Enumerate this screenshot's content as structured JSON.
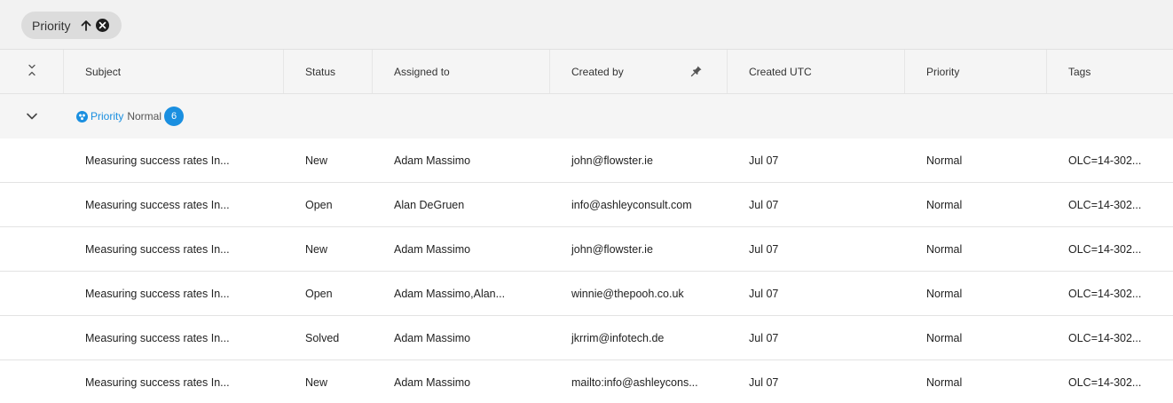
{
  "sort_chip": {
    "label": "Priority",
    "direction_icon": "arrow-up-icon",
    "remove_icon": "close-circle-icon"
  },
  "columns": [
    {
      "label": "Subject"
    },
    {
      "label": "Status"
    },
    {
      "label": "Assigned to"
    },
    {
      "label": "Created by",
      "icon": "pin-icon"
    },
    {
      "label": "Created UTC"
    },
    {
      "label": "Priority"
    },
    {
      "label": "Tags"
    }
  ],
  "group": {
    "field": "Priority",
    "value": "Normal",
    "count": "6",
    "icon": "group-icon",
    "accent_color": "#1a8fe0"
  },
  "rows": [
    {
      "subject": "Measuring success rates In...",
      "status": "New",
      "assigned": "Adam Massimo",
      "created_by": "john@flowster.ie",
      "created_utc": "Jul 07",
      "priority": "Normal",
      "tags": "OLC=14-302..."
    },
    {
      "subject": "Measuring success rates In...",
      "status": "Open",
      "assigned": "Alan DeGruen",
      "created_by": "info@ashleyconsult.com",
      "created_utc": "Jul 07",
      "priority": "Normal",
      "tags": "OLC=14-302..."
    },
    {
      "subject": "Measuring success rates In...",
      "status": "New",
      "assigned": "Adam Massimo",
      "created_by": "john@flowster.ie",
      "created_utc": "Jul 07",
      "priority": "Normal",
      "tags": "OLC=14-302..."
    },
    {
      "subject": "Measuring success rates In...",
      "status": "Open",
      "assigned": "Adam Massimo,Alan...",
      "created_by": "winnie@thepooh.co.uk",
      "created_utc": "Jul 07",
      "priority": "Normal",
      "tags": "OLC=14-302..."
    },
    {
      "subject": "Measuring success rates In...",
      "status": "Solved",
      "assigned": "Adam Massimo",
      "created_by": "jkrrim@infotech.de",
      "created_utc": "Jul 07",
      "priority": "Normal",
      "tags": "OLC=14-302..."
    },
    {
      "subject": "Measuring success rates In...",
      "status": "New",
      "assigned": "Adam Massimo",
      "created_by": "mailto:info@ashleycons...",
      "created_utc": "Jul 07",
      "priority": "Normal",
      "tags": "OLC=14-302..."
    }
  ]
}
